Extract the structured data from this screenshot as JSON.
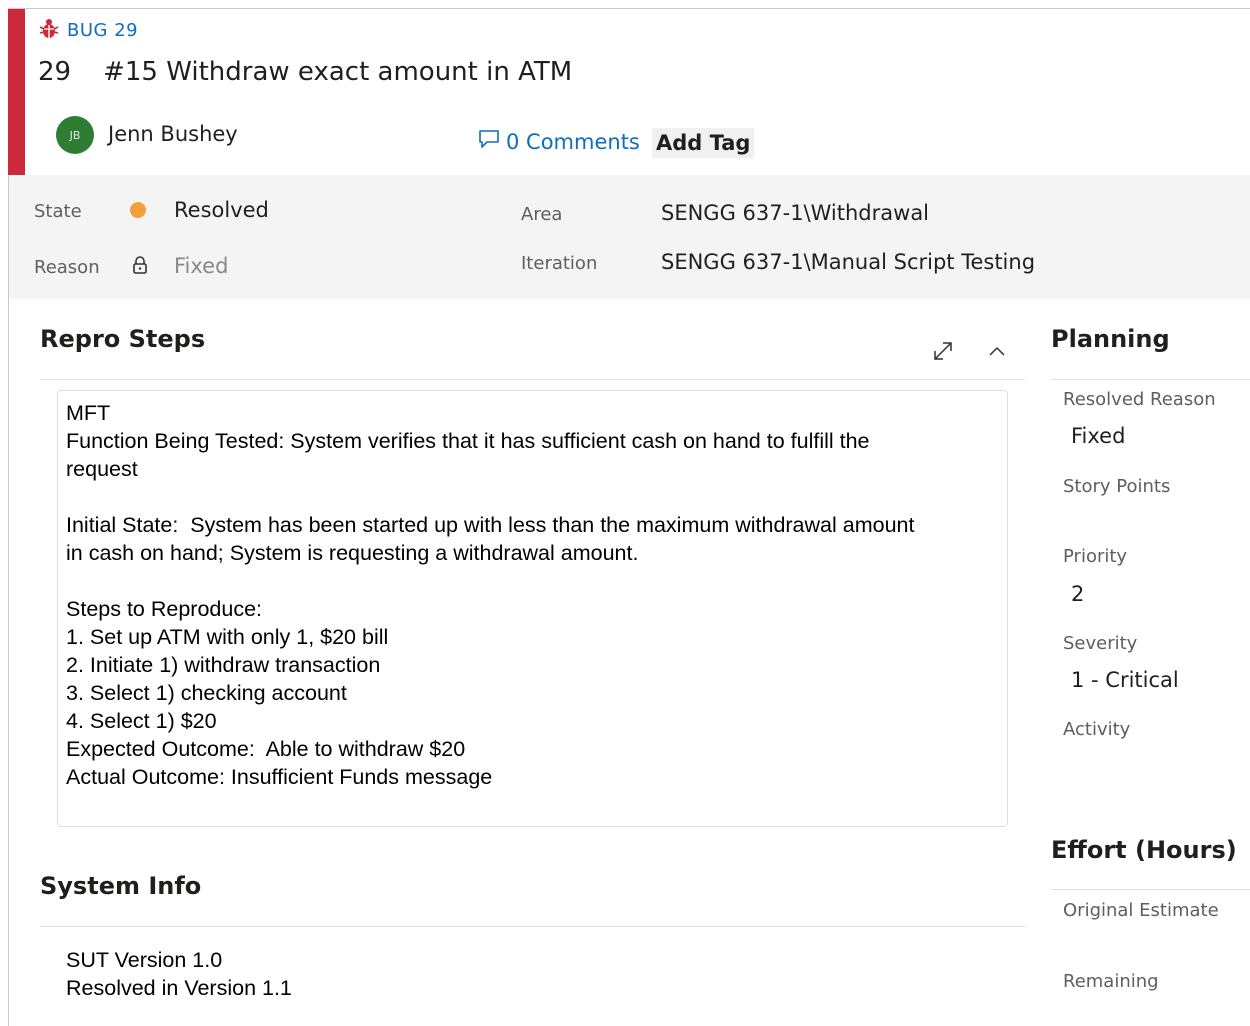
{
  "work_item": {
    "type_label": "BUG 29",
    "id": "29",
    "title": "#15 Withdraw exact amount in ATM",
    "assignee": {
      "initials": "JB",
      "name": "Jenn Bushey"
    },
    "comments_label": "0 Comments",
    "add_tag_label": "Add Tag",
    "accent_color": "#cc293d"
  },
  "fields": {
    "state": {
      "label": "State",
      "value": "Resolved",
      "dot_color": "#f2a03d"
    },
    "reason": {
      "label": "Reason",
      "value": "Fixed"
    },
    "area": {
      "label": "Area",
      "value": "SENGG 637-1\\Withdrawal"
    },
    "iteration": {
      "label": "Iteration",
      "value": "SENGG 637-1\\Manual Script Testing"
    }
  },
  "repro": {
    "title": "Repro Steps",
    "lines": [
      "MFT",
      "Function Being Tested: System verifies that it has sufficient cash on hand to fulfill the",
      "request",
      "",
      "Initial State:  System has been started up with less than the maximum withdrawal amount",
      "in cash on hand; System is requesting a withdrawal amount.",
      "",
      "Steps to Reproduce:",
      "1. Set up ATM with only 1, $20 bill",
      "2. Initiate 1) withdraw transaction",
      "3. Select 1) checking account",
      "4. Select 1) $20",
      "Expected Outcome:  Able to withdraw $20",
      "Actual Outcome: Insufficient Funds message"
    ]
  },
  "system_info": {
    "title": "System Info",
    "lines": [
      "SUT Version 1.0",
      "Resolved in Version 1.1"
    ]
  },
  "planning": {
    "title": "Planning",
    "resolved_reason": {
      "label": "Resolved Reason",
      "value": "Fixed"
    },
    "story_points": {
      "label": "Story Points",
      "value": ""
    },
    "priority": {
      "label": "Priority",
      "value": "2"
    },
    "severity": {
      "label": "Severity",
      "value": "1 - Critical"
    },
    "activity": {
      "label": "Activity",
      "value": ""
    }
  },
  "effort": {
    "title": "Effort (Hours)",
    "original_estimate": {
      "label": "Original Estimate",
      "value": ""
    },
    "remaining": {
      "label": "Remaining",
      "value": ""
    }
  }
}
